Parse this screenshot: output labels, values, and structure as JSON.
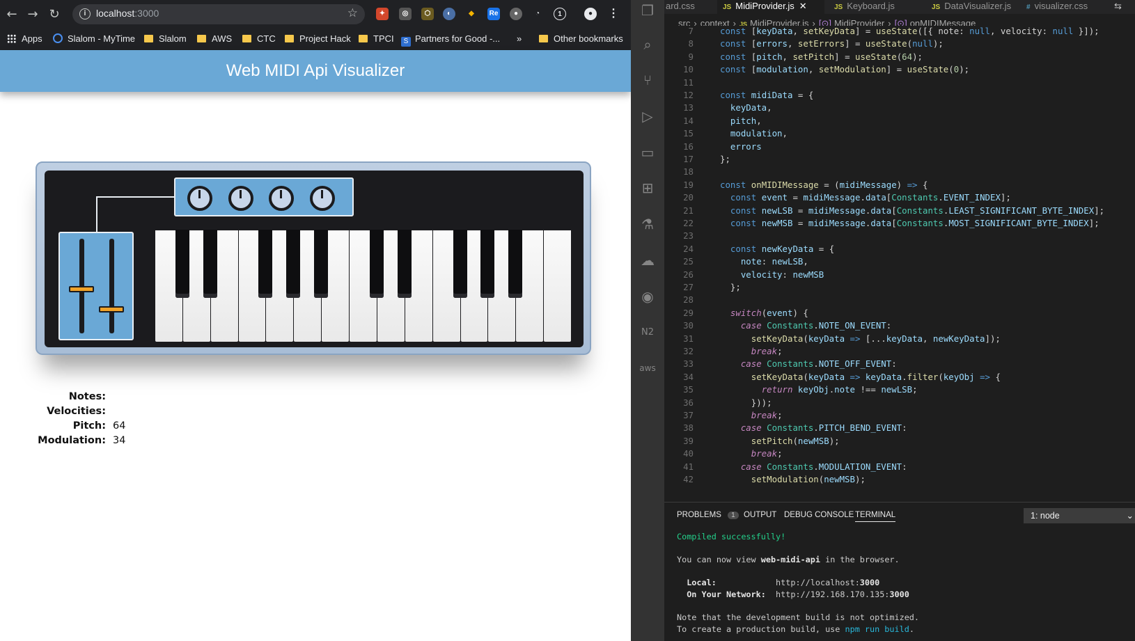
{
  "browser": {
    "url_host": "localhost",
    "url_port": ":3000",
    "bookmarks": {
      "apps": "Apps",
      "slalom_mytime": "Slalom - MyTime",
      "slalom": "Slalom",
      "aws": "AWS",
      "ctc": "CTC",
      "project_hack": "Project Hack",
      "tpci": "TPCI",
      "partners": "Partners for Good -...",
      "more": "»",
      "other": "Other bookmarks"
    }
  },
  "app": {
    "title": "Web MIDI Api Visualizer",
    "stats": {
      "notes_label": "Notes:",
      "notes_value": "",
      "velocities_label": "Velocities:",
      "velocities_value": "",
      "pitch_label": "Pitch:",
      "pitch_value": "64",
      "modulation_label": "Modulation:",
      "modulation_value": "34"
    },
    "sliders": {
      "pitch_level": 0.54,
      "modulation_level": 0.75
    }
  },
  "vscode": {
    "tabs": {
      "t0": "ard.css",
      "t1": "MidiProvider.js",
      "t2": "Keyboard.js",
      "t3": "DataVisualizer.js",
      "t4": "visualizer.css"
    },
    "breadcrumbs": {
      "b1": "src",
      "b2": "context",
      "b3": "MidiProvider.js",
      "b4": "MidiProvider",
      "b5": "onMIDIMessage"
    },
    "panel": {
      "problems": "PROBLEMS",
      "problems_count": "1",
      "output": "OUTPUT",
      "debug": "DEBUG CONSOLE",
      "terminal": "TERMINAL",
      "terminal_select": "1: node"
    },
    "terminal": {
      "l1": "Compiled successfully!",
      "l2a": "You can now view ",
      "l2b": "web-midi-api",
      "l2c": " in the browser.",
      "l3a": "  Local:",
      "l3b": "            http://localhost:",
      "l3c": "3000",
      "l4a": "  On Your Network:",
      "l4b": "  http://192.168.170.135:",
      "l4c": "3000",
      "l5": "Note that the development build is not optimized.",
      "l6a": "To create a production build, use ",
      "l6b": "npm run build",
      "l6c": "."
    }
  }
}
